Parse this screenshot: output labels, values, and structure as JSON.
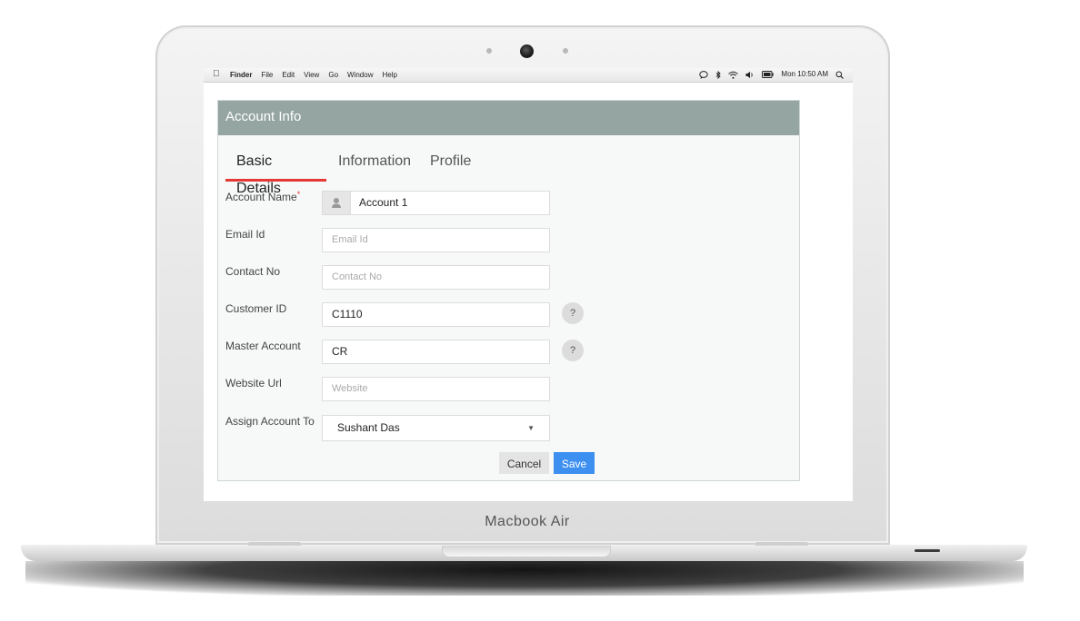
{
  "device": {
    "label": "Macbook Air"
  },
  "menubar": {
    "apple_icon": "apple-logo-icon",
    "items": [
      "Finder",
      "File",
      "Edit",
      "View",
      "Go",
      "Window",
      "Help"
    ],
    "clock": "Mon 10:50 AM",
    "status_icons": [
      "chat-bubble-icon",
      "bluetooth-icon",
      "wifi-icon",
      "volume-icon",
      "battery-icon",
      "search-icon"
    ]
  },
  "panel": {
    "title": "Account Info",
    "tabs": [
      {
        "label": "Basic Details",
        "active": true
      },
      {
        "label": "Information",
        "active": false
      },
      {
        "label": "Profile",
        "active": false
      }
    ],
    "fields": {
      "account_name": {
        "label": "Account Name",
        "required_mark": "*",
        "value": "Account 1",
        "icon": "user-icon"
      },
      "email": {
        "label": "Email Id",
        "placeholder": "Email Id"
      },
      "contact": {
        "label": "Contact No",
        "placeholder": "Contact No"
      },
      "customer_id": {
        "label": "Customer ID",
        "value": "C1110",
        "help": "?"
      },
      "master_account": {
        "label": "Master Account",
        "value": "CR",
        "help": "?"
      },
      "website": {
        "label": "Website Url",
        "placeholder": "Website"
      },
      "assign_to": {
        "label": "Assign Account To",
        "value": "Sushant Das",
        "caret": "▼"
      }
    },
    "buttons": {
      "cancel": "Cancel",
      "save": "Save"
    }
  },
  "colors": {
    "header_bg": "#95a5a2",
    "tab_underline": "#e53935",
    "save_button": "#3d8ff0",
    "cancel_button": "#e4e4e4"
  }
}
